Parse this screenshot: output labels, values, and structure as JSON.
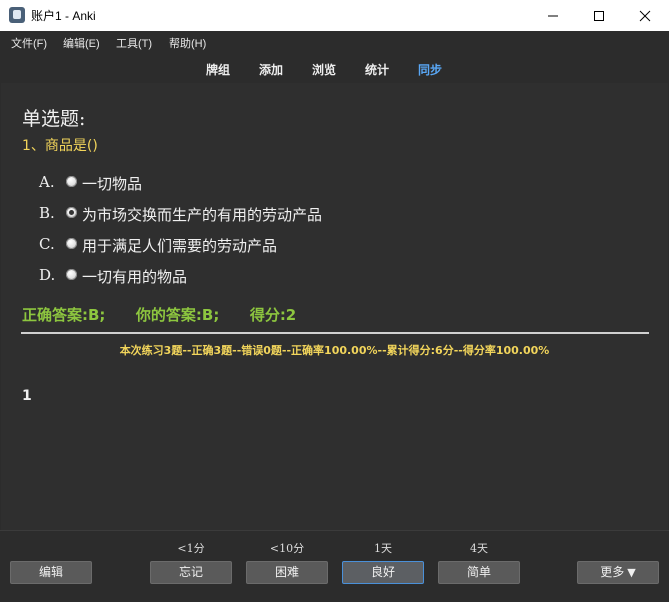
{
  "window": {
    "title": "账户1 - Anki"
  },
  "menu": {
    "items": [
      "文件(F)",
      "编辑(E)",
      "工具(T)",
      "帮助(H)"
    ]
  },
  "toolbar": {
    "decks": "牌组",
    "add": "添加",
    "browse": "浏览",
    "stats": "统计",
    "sync": "同步",
    "sync_color": "#59a7f5"
  },
  "card": {
    "section_title": "单选题:",
    "question": "1、商品是()",
    "options": [
      {
        "letter": "A.",
        "text": "一切物品",
        "checked": false
      },
      {
        "letter": "B.",
        "text": "为市场交换而生产的有用的劳动产品",
        "checked": true
      },
      {
        "letter": "C.",
        "text": "用于满足人们需要的劳动产品",
        "checked": false
      },
      {
        "letter": "D.",
        "text": "一切有用的物品",
        "checked": false
      }
    ],
    "correct_answer": "正确答案:B;",
    "your_answer": "你的答案:B;",
    "score": "得分:2",
    "stats_line": "本次练习3题--正确3题--错误0题--正确率100.00%--累计得分:6分--得分率100.00%",
    "note_number": "1",
    "answer_color": "#8dc63f",
    "highlight_color": "#f2d55b"
  },
  "bottom": {
    "edit": "编辑",
    "more": "更多",
    "more_icon": "triangle-down",
    "answers": [
      {
        "interval": "<1分",
        "label": "忘记"
      },
      {
        "interval": "<10分",
        "label": "困难"
      },
      {
        "interval": "1天",
        "label": "良好"
      },
      {
        "interval": "4天",
        "label": "简单"
      }
    ]
  }
}
